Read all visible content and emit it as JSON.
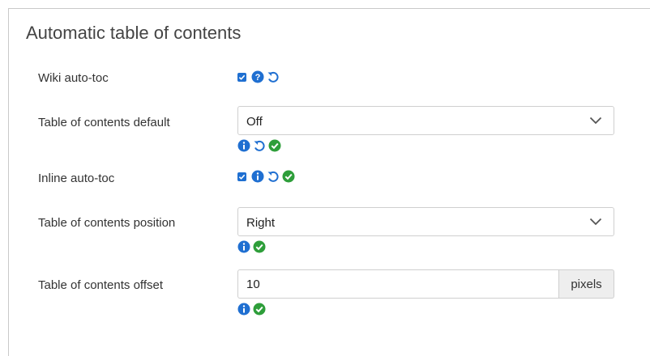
{
  "section": {
    "title": "Automatic table of contents"
  },
  "rows": {
    "wiki_auto_toc": {
      "label": "Wiki auto-toc",
      "checked": true
    },
    "toc_default": {
      "label": "Table of contents default",
      "selected": "Off"
    },
    "inline_auto_toc": {
      "label": "Inline auto-toc",
      "checked": true
    },
    "toc_position": {
      "label": "Table of contents position",
      "selected": "Right"
    },
    "toc_offset": {
      "label": "Table of contents offset",
      "value": "10",
      "unit": "pixels"
    }
  },
  "icons": {
    "help": "question-circle-icon",
    "info": "info-circle-icon",
    "reset": "undo-icon",
    "ok": "check-circle-icon"
  },
  "colors": {
    "blue": "#1f6fd1",
    "green": "#2e9e3a",
    "border": "#cfcfcf"
  }
}
